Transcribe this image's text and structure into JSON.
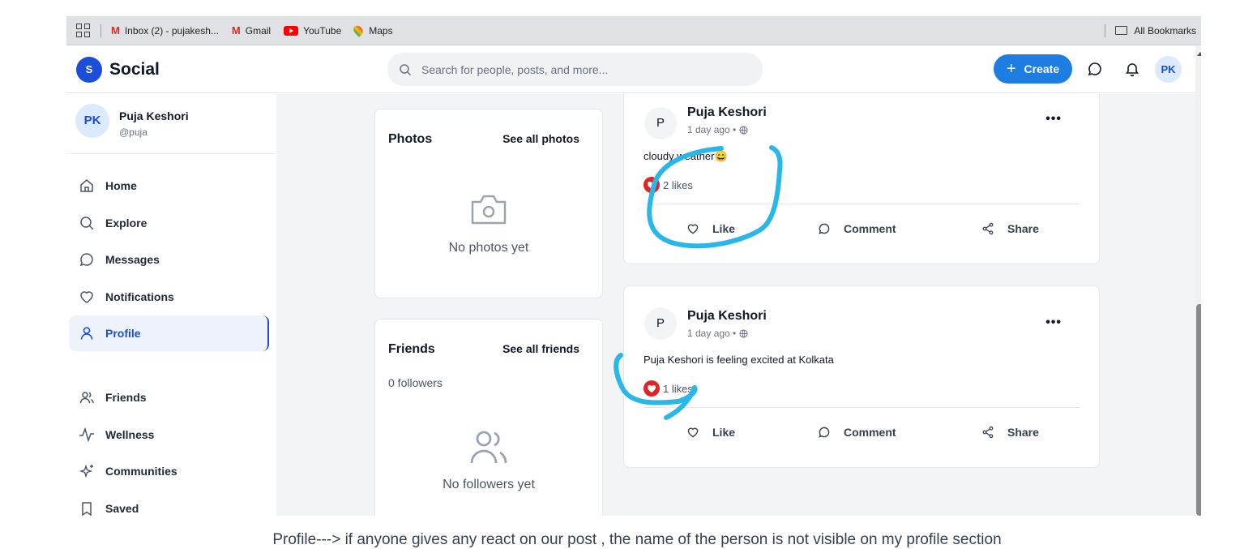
{
  "bookmarks": {
    "items": [
      {
        "icon": "gmail-icon",
        "label": "Inbox (2) - pujakesh..."
      },
      {
        "icon": "gmail-icon",
        "label": "Gmail"
      },
      {
        "icon": "youtube-icon",
        "label": "YouTube"
      },
      {
        "icon": "maps-icon",
        "label": "Maps"
      }
    ],
    "all_label": "All Bookmarks"
  },
  "header": {
    "logo_letter": "S",
    "app_name": "Social",
    "search_placeholder": "Search for people, posts, and more...",
    "create_label": "Create",
    "avatar_initials": "PK"
  },
  "sidebar": {
    "user": {
      "initials": "PK",
      "name": "Puja Keshori",
      "handle": "@puja"
    },
    "items": [
      {
        "label": "Home",
        "icon": "home-icon"
      },
      {
        "label": "Explore",
        "icon": "search-icon"
      },
      {
        "label": "Messages",
        "icon": "message-icon"
      },
      {
        "label": "Notifications",
        "icon": "heart-icon"
      },
      {
        "label": "Profile",
        "icon": "user-icon",
        "active": true
      },
      {
        "label": "Friends",
        "icon": "users-icon"
      },
      {
        "label": "Wellness",
        "icon": "activity-icon"
      },
      {
        "label": "Communities",
        "icon": "sparkles-icon"
      },
      {
        "label": "Saved",
        "icon": "bookmark-icon"
      }
    ]
  },
  "photos_card": {
    "title": "Photos",
    "link": "See all photos",
    "empty": "No photos yet"
  },
  "friends_card": {
    "title": "Friends",
    "link": "See all friends",
    "count": "0 followers",
    "empty": "No followers yet"
  },
  "posts": [
    {
      "avatar": "P",
      "author": "Puja Keshori",
      "time": "1 day ago •",
      "text": "cloudy weather😄",
      "likes": "2 likes",
      "actions": [
        "Like",
        "Comment",
        "Share"
      ]
    },
    {
      "avatar": "P",
      "author": "Puja Keshori",
      "time": "1 day ago •",
      "text": "Puja Keshori is feeling excited at Kolkata",
      "likes": "1 likes",
      "actions": [
        "Like",
        "Comment",
        "Share"
      ]
    }
  ],
  "annotation_color": "#29b6e8",
  "accent_color": "#1d7de0",
  "caption": "Profile---> if anyone gives any react on our post , the name of the person is not visible on my profile section"
}
